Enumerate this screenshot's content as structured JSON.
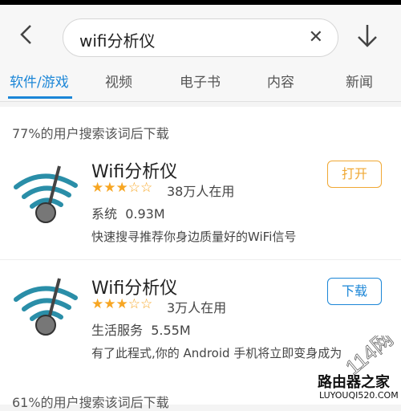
{
  "search": {
    "query": "wifi分析仪",
    "clear_icon": "close-icon"
  },
  "tabs": [
    {
      "label": "软件/游戏",
      "active": true
    },
    {
      "label": "视频"
    },
    {
      "label": "电子书"
    },
    {
      "label": "内容"
    },
    {
      "label": "新闻"
    }
  ],
  "sections": [
    {
      "label": "77%的用户搜索该词后下载"
    },
    {
      "label": "61%的用户搜索该词后下载"
    }
  ],
  "apps": [
    {
      "name": "Wifi分析仪",
      "rating": 3,
      "downloads": "38万人在用",
      "category": "系统",
      "size": "0.93M",
      "description": "快速搜寻推荐你身边质量好的WiFi信号",
      "action": "打开"
    },
    {
      "name": "Wifi分析仪",
      "rating": 3,
      "downloads": "3万人在用",
      "category": "生活服务",
      "size": "5.55M",
      "description": "有了此程式,你的 Android 手机将立即变身成为",
      "action": "下载"
    }
  ],
  "watermark": {
    "text": "路由器之家",
    "url": "LUYOUQI520.COM",
    "badge": "114网"
  },
  "colors": {
    "accent": "#1b86d7",
    "open": "#f0a834",
    "star": "#f7a623"
  }
}
